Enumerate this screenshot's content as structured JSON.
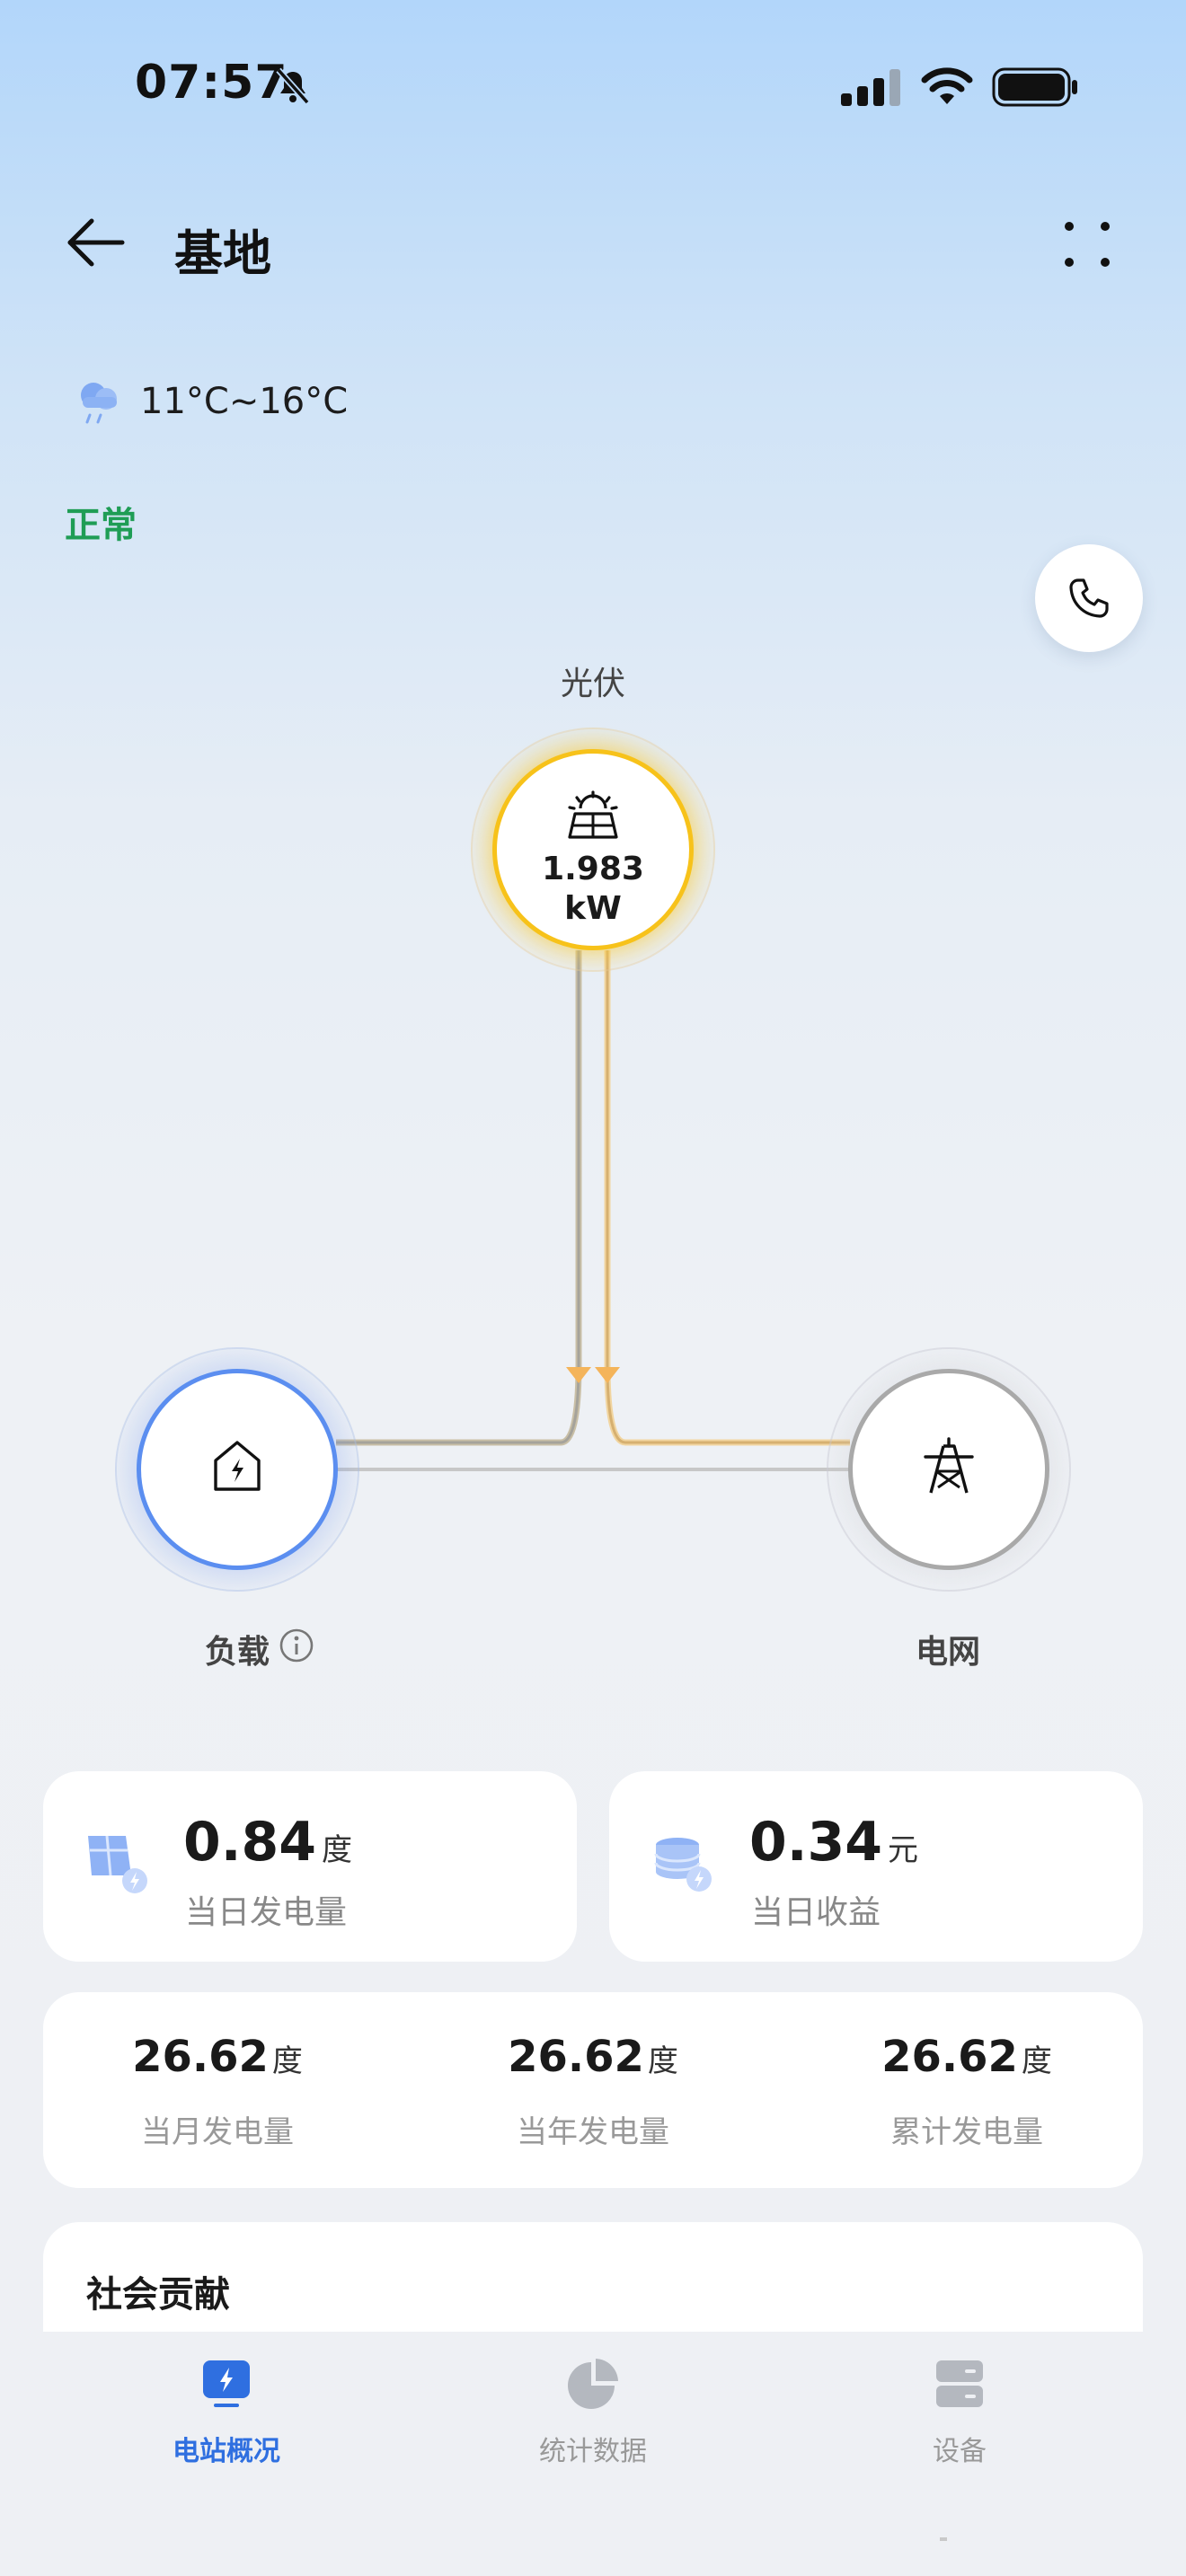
{
  "status_bar": {
    "time": "07:57"
  },
  "header": {
    "title": "基地"
  },
  "weather": {
    "temp_range": "11°C~16°C"
  },
  "station_status": "正常",
  "flow": {
    "pv": {
      "label": "光伏",
      "power_value": "1.983",
      "power_unit": "kW"
    },
    "load": {
      "label": "负载"
    },
    "grid": {
      "label": "电网"
    }
  },
  "kpis": {
    "daily_gen": {
      "value": "0.84",
      "unit": "度",
      "label": "当日发电量"
    },
    "daily_income": {
      "value": "0.34",
      "unit": "元",
      "label": "当日收益"
    }
  },
  "stats": [
    {
      "value": "26.62",
      "unit": "度",
      "label": "当月发电量"
    },
    {
      "value": "26.62",
      "unit": "度",
      "label": "当年发电量"
    },
    {
      "value": "26.62",
      "unit": "度",
      "label": "累计发电量"
    }
  ],
  "social": {
    "title": "社会贡献"
  },
  "tabbar": {
    "tabs": [
      {
        "label": "电站概况",
        "icon": "station-overview-icon",
        "active": true
      },
      {
        "label": "统计数据",
        "icon": "pie-chart-icon",
        "active": false
      },
      {
        "label": "设备",
        "icon": "device-icon",
        "active": false
      }
    ]
  },
  "colors": {
    "accent": "#2f6fe0",
    "pv": "#f7c21a",
    "load": "#5b8ef0",
    "grid": "#a9a9a9",
    "status_ok": "#1f9d55"
  }
}
